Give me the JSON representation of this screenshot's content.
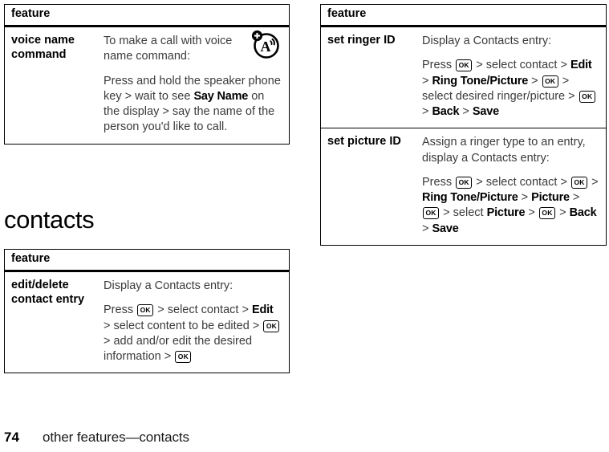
{
  "page": {
    "folio": "74",
    "running_head": "other features—contacts",
    "section_heading": "contacts"
  },
  "tables": [
    {
      "id": "voice-name-command-table",
      "header": "feature",
      "rows": [
        {
          "term": "voice name command",
          "has_voice_icon": true,
          "icon_name": "voice-name-command-icon",
          "paragraphs": [
            [
              {
                "t": "text",
                "v": "To make a call with voice name command:"
              }
            ],
            [
              {
                "t": "text",
                "v": "Press and hold the speaker phone key > wait to see "
              },
              {
                "t": "bold",
                "v": "Say Name"
              },
              {
                "t": "text",
                "v": " on the display > say the name of the person you'd like to call."
              }
            ]
          ]
        }
      ]
    },
    {
      "id": "contacts-edit-delete-table",
      "header": "feature",
      "rows": [
        {
          "term": "edit/delete contact entry",
          "has_voice_icon": false,
          "paragraphs": [
            [
              {
                "t": "text",
                "v": "Display a Contacts entry:"
              }
            ],
            [
              {
                "t": "text",
                "v": "Press "
              },
              {
                "t": "key",
                "v": "OK"
              },
              {
                "t": "text",
                "v": " > select contact > "
              },
              {
                "t": "bold",
                "v": "Edit"
              },
              {
                "t": "text",
                "v": " > select content to be edited > "
              },
              {
                "t": "key",
                "v": "OK"
              },
              {
                "t": "text",
                "v": " > add and/or edit the desired information > "
              },
              {
                "t": "key",
                "v": "OK"
              }
            ]
          ]
        }
      ]
    },
    {
      "id": "ringer-picture-id-table",
      "header": "feature",
      "rows": [
        {
          "term": "set ringer ID",
          "has_voice_icon": false,
          "paragraphs": [
            [
              {
                "t": "text",
                "v": "Display a Contacts entry:"
              }
            ],
            [
              {
                "t": "text",
                "v": "Press "
              },
              {
                "t": "key",
                "v": "OK"
              },
              {
                "t": "text",
                "v": " > select contact > "
              },
              {
                "t": "bold",
                "v": "Edit"
              },
              {
                "t": "text",
                "v": " > "
              },
              {
                "t": "bold",
                "v": "Ring Tone/Picture"
              },
              {
                "t": "text",
                "v": " > "
              },
              {
                "t": "key",
                "v": "OK"
              },
              {
                "t": "text",
                "v": " > select desired ringer/picture > "
              },
              {
                "t": "key",
                "v": "OK"
              },
              {
                "t": "text",
                "v": " > "
              },
              {
                "t": "bold",
                "v": "Back"
              },
              {
                "t": "text",
                "v": " > "
              },
              {
                "t": "bold",
                "v": "Save"
              }
            ]
          ]
        },
        {
          "term": "set picture ID",
          "has_voice_icon": false,
          "paragraphs": [
            [
              {
                "t": "text",
                "v": "Assign a ringer type to an entry, display a Contacts entry:"
              }
            ],
            [
              {
                "t": "text",
                "v": "Press "
              },
              {
                "t": "key",
                "v": "OK"
              },
              {
                "t": "text",
                "v": " > select contact > "
              },
              {
                "t": "key",
                "v": "OK"
              },
              {
                "t": "text",
                "v": " > "
              },
              {
                "t": "bold",
                "v": "Ring Tone/Picture"
              },
              {
                "t": "text",
                "v": " > "
              },
              {
                "t": "bold",
                "v": "Picture"
              },
              {
                "t": "text",
                "v": " > "
              },
              {
                "t": "key",
                "v": "OK"
              },
              {
                "t": "text",
                "v": " > select "
              },
              {
                "t": "bold",
                "v": "Picture"
              },
              {
                "t": "text",
                "v": " > "
              },
              {
                "t": "key",
                "v": "OK"
              },
              {
                "t": "text",
                "v": " > "
              },
              {
                "t": "bold",
                "v": "Back"
              },
              {
                "t": "text",
                "v": " > "
              },
              {
                "t": "bold",
                "v": "Save"
              }
            ]
          ]
        }
      ]
    }
  ],
  "colors": {
    "ink": "#000000",
    "body_text": "#3b3b3b",
    "paper": "#ffffff"
  }
}
